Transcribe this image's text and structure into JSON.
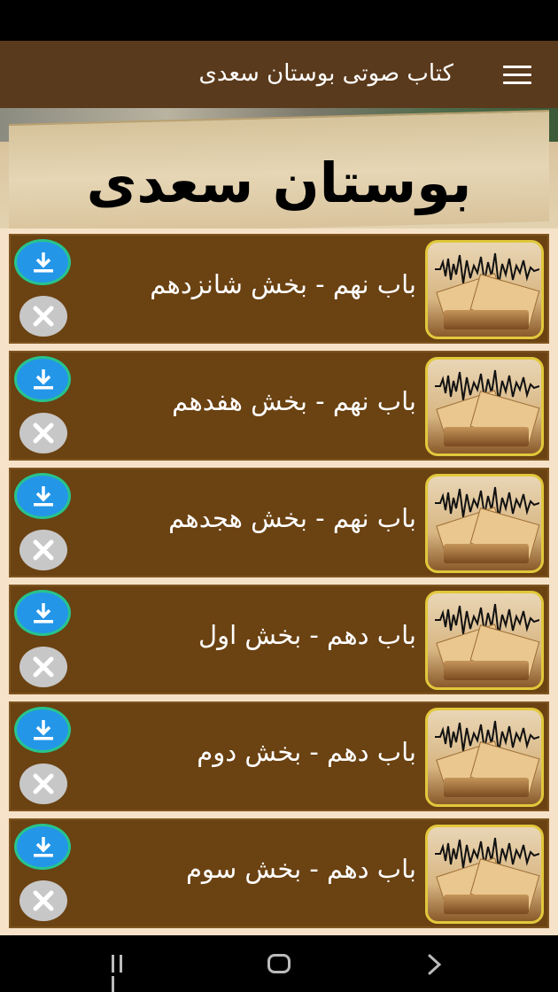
{
  "app_bar": {
    "title": "کتاب صوتی بوستان سعدی",
    "menu_icon": "hamburger-menu-icon"
  },
  "banner": {
    "title": "بوستان سعدی"
  },
  "tracks": [
    {
      "title": "باب نهم - بخش شانزدهم"
    },
    {
      "title": "باب نهم - بخش هفدهم"
    },
    {
      "title": "باب نهم - بخش هجدهم"
    },
    {
      "title": "باب دهم - بخش اول"
    },
    {
      "title": "باب دهم - بخش دوم"
    },
    {
      "title": "باب دهم - بخش سوم"
    }
  ],
  "icons": {
    "download": "download-icon",
    "delete": "close-icon",
    "thumbnail": "book-audio-wave-image"
  },
  "colors": {
    "app_bar": "#5a3a1c",
    "item_background": "#6b4212",
    "list_background": "#f6e2c8",
    "download_button": "#2496e8",
    "download_ring": "#27c48c",
    "delete_button": "#c7c7c7",
    "thumb_border": "#e1c83c"
  }
}
